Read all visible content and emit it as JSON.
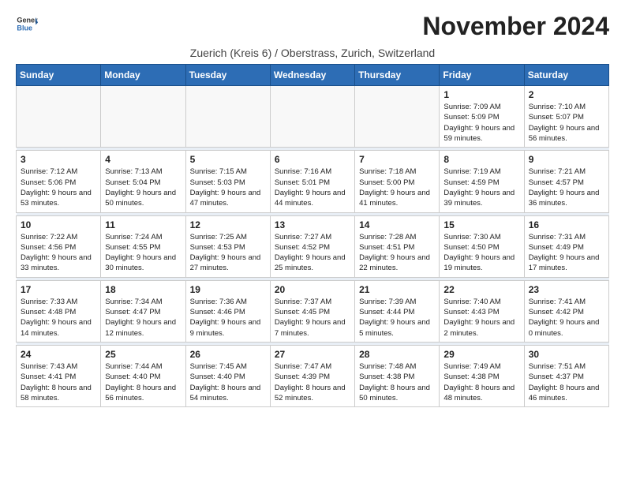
{
  "header": {
    "logo_general": "General",
    "logo_blue": "Blue",
    "title": "November 2024",
    "subtitle": "Zuerich (Kreis 6) / Oberstrass, Zurich, Switzerland"
  },
  "days_of_week": [
    "Sunday",
    "Monday",
    "Tuesday",
    "Wednesday",
    "Thursday",
    "Friday",
    "Saturday"
  ],
  "weeks": [
    [
      {
        "day": "",
        "empty": true
      },
      {
        "day": "",
        "empty": true
      },
      {
        "day": "",
        "empty": true
      },
      {
        "day": "",
        "empty": true
      },
      {
        "day": "",
        "empty": true
      },
      {
        "day": "1",
        "sunrise": "Sunrise: 7:09 AM",
        "sunset": "Sunset: 5:09 PM",
        "daylight": "Daylight: 9 hours and 59 minutes."
      },
      {
        "day": "2",
        "sunrise": "Sunrise: 7:10 AM",
        "sunset": "Sunset: 5:07 PM",
        "daylight": "Daylight: 9 hours and 56 minutes."
      }
    ],
    [
      {
        "day": "3",
        "sunrise": "Sunrise: 7:12 AM",
        "sunset": "Sunset: 5:06 PM",
        "daylight": "Daylight: 9 hours and 53 minutes."
      },
      {
        "day": "4",
        "sunrise": "Sunrise: 7:13 AM",
        "sunset": "Sunset: 5:04 PM",
        "daylight": "Daylight: 9 hours and 50 minutes."
      },
      {
        "day": "5",
        "sunrise": "Sunrise: 7:15 AM",
        "sunset": "Sunset: 5:03 PM",
        "daylight": "Daylight: 9 hours and 47 minutes."
      },
      {
        "day": "6",
        "sunrise": "Sunrise: 7:16 AM",
        "sunset": "Sunset: 5:01 PM",
        "daylight": "Daylight: 9 hours and 44 minutes."
      },
      {
        "day": "7",
        "sunrise": "Sunrise: 7:18 AM",
        "sunset": "Sunset: 5:00 PM",
        "daylight": "Daylight: 9 hours and 41 minutes."
      },
      {
        "day": "8",
        "sunrise": "Sunrise: 7:19 AM",
        "sunset": "Sunset: 4:59 PM",
        "daylight": "Daylight: 9 hours and 39 minutes."
      },
      {
        "day": "9",
        "sunrise": "Sunrise: 7:21 AM",
        "sunset": "Sunset: 4:57 PM",
        "daylight": "Daylight: 9 hours and 36 minutes."
      }
    ],
    [
      {
        "day": "10",
        "sunrise": "Sunrise: 7:22 AM",
        "sunset": "Sunset: 4:56 PM",
        "daylight": "Daylight: 9 hours and 33 minutes."
      },
      {
        "day": "11",
        "sunrise": "Sunrise: 7:24 AM",
        "sunset": "Sunset: 4:55 PM",
        "daylight": "Daylight: 9 hours and 30 minutes."
      },
      {
        "day": "12",
        "sunrise": "Sunrise: 7:25 AM",
        "sunset": "Sunset: 4:53 PM",
        "daylight": "Daylight: 9 hours and 27 minutes."
      },
      {
        "day": "13",
        "sunrise": "Sunrise: 7:27 AM",
        "sunset": "Sunset: 4:52 PM",
        "daylight": "Daylight: 9 hours and 25 minutes."
      },
      {
        "day": "14",
        "sunrise": "Sunrise: 7:28 AM",
        "sunset": "Sunset: 4:51 PM",
        "daylight": "Daylight: 9 hours and 22 minutes."
      },
      {
        "day": "15",
        "sunrise": "Sunrise: 7:30 AM",
        "sunset": "Sunset: 4:50 PM",
        "daylight": "Daylight: 9 hours and 19 minutes."
      },
      {
        "day": "16",
        "sunrise": "Sunrise: 7:31 AM",
        "sunset": "Sunset: 4:49 PM",
        "daylight": "Daylight: 9 hours and 17 minutes."
      }
    ],
    [
      {
        "day": "17",
        "sunrise": "Sunrise: 7:33 AM",
        "sunset": "Sunset: 4:48 PM",
        "daylight": "Daylight: 9 hours and 14 minutes."
      },
      {
        "day": "18",
        "sunrise": "Sunrise: 7:34 AM",
        "sunset": "Sunset: 4:47 PM",
        "daylight": "Daylight: 9 hours and 12 minutes."
      },
      {
        "day": "19",
        "sunrise": "Sunrise: 7:36 AM",
        "sunset": "Sunset: 4:46 PM",
        "daylight": "Daylight: 9 hours and 9 minutes."
      },
      {
        "day": "20",
        "sunrise": "Sunrise: 7:37 AM",
        "sunset": "Sunset: 4:45 PM",
        "daylight": "Daylight: 9 hours and 7 minutes."
      },
      {
        "day": "21",
        "sunrise": "Sunrise: 7:39 AM",
        "sunset": "Sunset: 4:44 PM",
        "daylight": "Daylight: 9 hours and 5 minutes."
      },
      {
        "day": "22",
        "sunrise": "Sunrise: 7:40 AM",
        "sunset": "Sunset: 4:43 PM",
        "daylight": "Daylight: 9 hours and 2 minutes."
      },
      {
        "day": "23",
        "sunrise": "Sunrise: 7:41 AM",
        "sunset": "Sunset: 4:42 PM",
        "daylight": "Daylight: 9 hours and 0 minutes."
      }
    ],
    [
      {
        "day": "24",
        "sunrise": "Sunrise: 7:43 AM",
        "sunset": "Sunset: 4:41 PM",
        "daylight": "Daylight: 8 hours and 58 minutes."
      },
      {
        "day": "25",
        "sunrise": "Sunrise: 7:44 AM",
        "sunset": "Sunset: 4:40 PM",
        "daylight": "Daylight: 8 hours and 56 minutes."
      },
      {
        "day": "26",
        "sunrise": "Sunrise: 7:45 AM",
        "sunset": "Sunset: 4:40 PM",
        "daylight": "Daylight: 8 hours and 54 minutes."
      },
      {
        "day": "27",
        "sunrise": "Sunrise: 7:47 AM",
        "sunset": "Sunset: 4:39 PM",
        "daylight": "Daylight: 8 hours and 52 minutes."
      },
      {
        "day": "28",
        "sunrise": "Sunrise: 7:48 AM",
        "sunset": "Sunset: 4:38 PM",
        "daylight": "Daylight: 8 hours and 50 minutes."
      },
      {
        "day": "29",
        "sunrise": "Sunrise: 7:49 AM",
        "sunset": "Sunset: 4:38 PM",
        "daylight": "Daylight: 8 hours and 48 minutes."
      },
      {
        "day": "30",
        "sunrise": "Sunrise: 7:51 AM",
        "sunset": "Sunset: 4:37 PM",
        "daylight": "Daylight: 8 hours and 46 minutes."
      }
    ]
  ]
}
